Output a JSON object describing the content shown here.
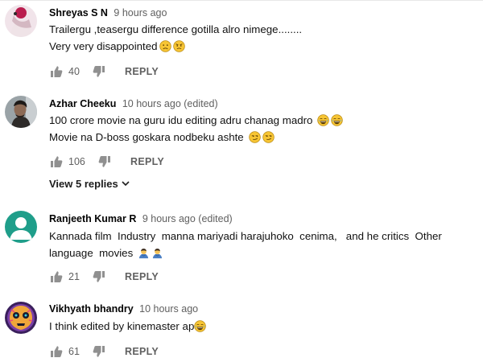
{
  "comments": [
    {
      "author": "Shreyas S N",
      "time": "9 hours ago",
      "lines": [
        "Trailergu ,teasergu difference gotilla alro nimege........",
        "Very very disappointed"
      ],
      "line2_emojis": [
        "sad-face-emoji",
        "angry-face-emoji"
      ],
      "likes": "40",
      "reply_label": "REPLY"
    },
    {
      "author": "Azhar Cheeku",
      "time": "10 hours ago (edited)",
      "lines": [
        "100 crore movie na guru idu editing adru chanag madro",
        "Movie na D-boss goskara nodbeku ashte"
      ],
      "line1_emojis": [
        "laughing-face-emoji",
        "laughing-face-emoji"
      ],
      "line2_emojis": [
        "smirk-face-emoji",
        "smirk-face-emoji"
      ],
      "likes": "106",
      "reply_label": "REPLY",
      "view_replies": "View 5 replies"
    },
    {
      "author": "Ranjeeth Kumar R",
      "time": "9 hours ago (edited)",
      "lines": [
        "Kannada film  Industry  manna mariyadi harajuhoko  cenima,   and he critics  Other",
        "language  movies"
      ],
      "line2_emojis": [
        "person-bowing-emoji",
        "person-bowing-emoji"
      ],
      "likes": "21",
      "reply_label": "REPLY"
    },
    {
      "author": "Vikhyath bhandry",
      "time": "10 hours ago",
      "lines": [
        "I think edited by kinemaster ap"
      ],
      "line1_emojis": [
        "laughing-face-emoji"
      ],
      "likes": "61",
      "reply_label": "REPLY"
    }
  ],
  "colors": {
    "meta_text": "#606060",
    "icon": "#909090",
    "default_avatar": "#1f9e8a"
  }
}
